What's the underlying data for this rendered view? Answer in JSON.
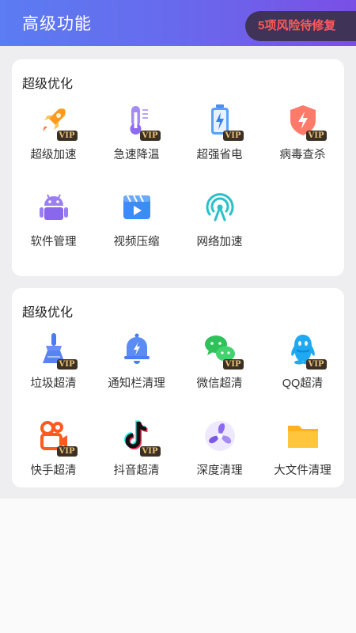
{
  "header": {
    "title": "高级功能",
    "risk_badge": "5项风险待修复"
  },
  "sections": [
    {
      "title": "超级优化",
      "items": [
        {
          "label": "超级加速",
          "vip": "VIP",
          "icon": "rocket-icon"
        },
        {
          "label": "急速降温",
          "vip": "VIP",
          "icon": "thermometer-icon"
        },
        {
          "label": "超强省电",
          "vip": "VIP",
          "icon": "battery-icon"
        },
        {
          "label": "病毒查杀",
          "vip": "VIP",
          "icon": "shield-icon"
        },
        {
          "label": "软件管理",
          "icon": "android-icon"
        },
        {
          "label": "视频压缩",
          "icon": "video-icon"
        },
        {
          "label": "网络加速",
          "icon": "signal-icon"
        }
      ]
    },
    {
      "title": "超级优化",
      "items": [
        {
          "label": "垃圾超清",
          "vip": "VIP",
          "icon": "broom-icon"
        },
        {
          "label": "通知栏清理",
          "icon": "bell-icon"
        },
        {
          "label": "微信超清",
          "vip": "VIP",
          "icon": "wechat-icon"
        },
        {
          "label": "QQ超清",
          "vip": "VIP",
          "icon": "qq-icon"
        },
        {
          "label": "快手超清",
          "vip": "VIP",
          "icon": "kuaishou-icon"
        },
        {
          "label": "抖音超清",
          "vip": "VIP",
          "icon": "tiktok-icon"
        },
        {
          "label": "深度清理",
          "icon": "fan-icon"
        },
        {
          "label": "大文件清理",
          "icon": "folder-icon"
        }
      ]
    }
  ]
}
